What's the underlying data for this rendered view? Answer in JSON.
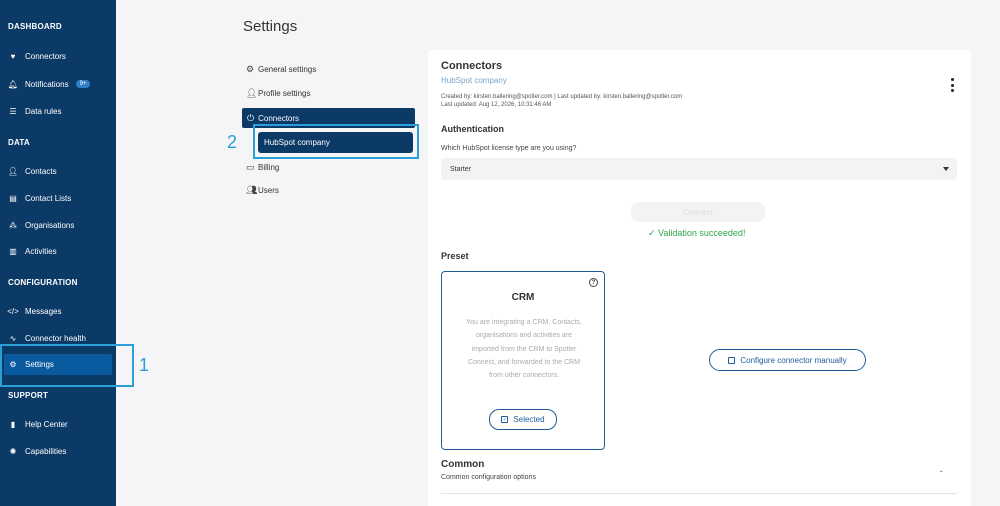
{
  "sidebar": {
    "sections": {
      "dashboard": "DASHBOARD",
      "data": "DATA",
      "configuration": "CONFIGURATION",
      "support": "SUPPORT"
    },
    "items": [
      {
        "label": "Connectors",
        "icon": "heart-plug-icon"
      },
      {
        "label": "Notifications",
        "icon": "bell-icon",
        "badge": "9+"
      },
      {
        "label": "Data rules",
        "icon": "list-icon"
      },
      {
        "label": "Contacts",
        "icon": "person-icon"
      },
      {
        "label": "Contact Lists",
        "icon": "contact-list-icon"
      },
      {
        "label": "Organisations",
        "icon": "organisation-icon"
      },
      {
        "label": "Activities",
        "icon": "clipboard-icon"
      },
      {
        "label": "Messages",
        "icon": "code-icon"
      },
      {
        "label": "Connector health",
        "icon": "pulse-icon"
      },
      {
        "label": "Settings",
        "icon": "gear-icon",
        "active": true
      },
      {
        "label": "Help Center",
        "icon": "book-icon"
      },
      {
        "label": "Capabilities",
        "icon": "lightbulb-icon"
      }
    ]
  },
  "annotations": {
    "one": "1",
    "two": "2"
  },
  "page": {
    "title": "Settings"
  },
  "subnav": {
    "general": "General settings",
    "profile": "Profile settings",
    "connectors": "Connectors",
    "hubspot": "HubSpot company",
    "billing": "Billing",
    "users": "Users"
  },
  "card": {
    "title": "Connectors",
    "subtitle": "HubSpot company",
    "created_line": "Created by: kirsten.ballering@spotler.com | Last updated by: kirsten.ballering@spotler.com",
    "updated_line": "Last updated: Aug 12, 2026, 10:31:46 AM",
    "auth_heading": "Authentication",
    "license_question": "Which HubSpot license type are you using?",
    "license_value": "Starter",
    "connect_label": "Connect",
    "validation": "Validation succeeded!",
    "preset_heading": "Preset",
    "preset_title": "CRM",
    "preset_desc": "You are integrating a CRM. Contacts, organisations and activities are imported from the CRM to Spotler Connect, and forwarded to the CRM from other connectors.",
    "selected_label": "Selected",
    "manual_label": "Configure connector manually",
    "common_heading": "Common",
    "common_sub": "Common configuration options"
  },
  "colors": {
    "sidebar": "#0c3a66",
    "active": "#0a5aa0",
    "accent": "#1f5c9a",
    "annotation": "#2b9fd8",
    "success": "#2ea84a"
  }
}
